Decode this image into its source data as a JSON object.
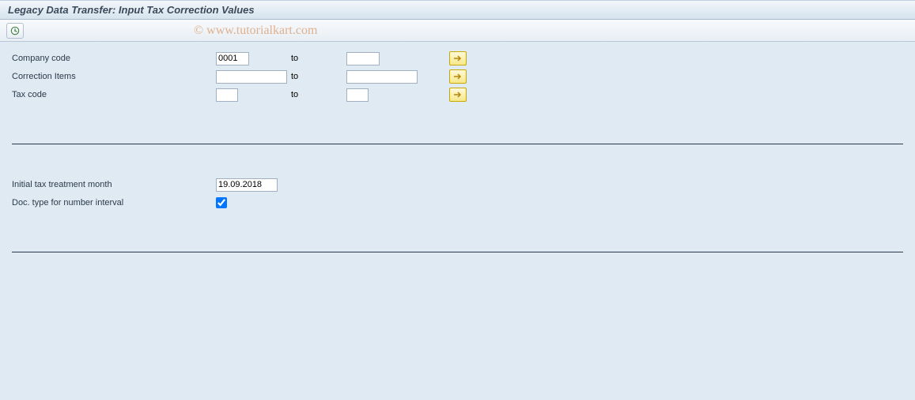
{
  "title": "Legacy Data Transfer: Input Tax Correction Values",
  "watermark": "© www.tutorialkart.com",
  "selection": {
    "company_code": {
      "label": "Company code",
      "from": "0001",
      "to_label": "to",
      "to": ""
    },
    "correction_items": {
      "label": "Correction Items",
      "from": "",
      "to_label": "to",
      "to": ""
    },
    "tax_code": {
      "label": "Tax code",
      "from": "",
      "to_label": "to",
      "to": ""
    }
  },
  "params": {
    "initial_month": {
      "label": "Initial tax treatment month",
      "value": "19.09.2018"
    },
    "doc_type": {
      "label": "Doc. type for number interval",
      "checked": true
    }
  }
}
